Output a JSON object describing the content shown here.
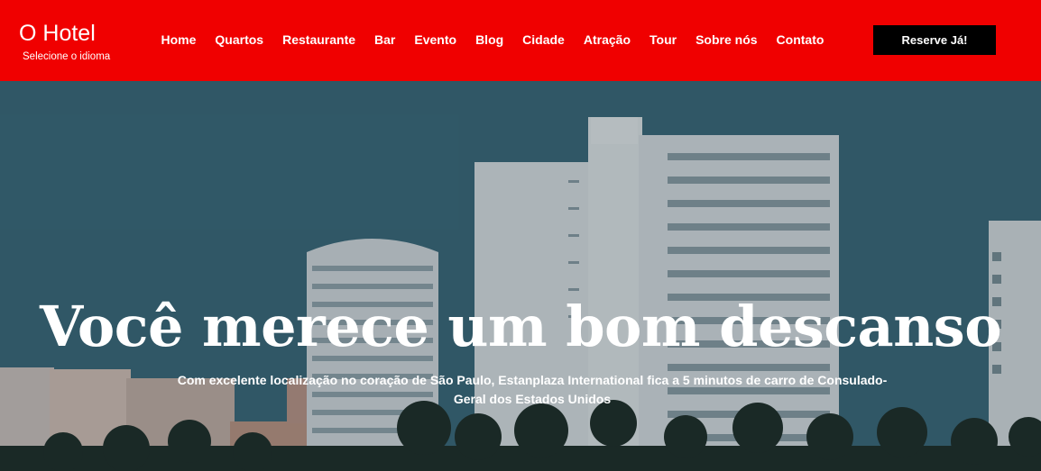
{
  "brand": {
    "title": "O Hotel",
    "language_label": "Selecione o idioma"
  },
  "nav": {
    "items": [
      {
        "label": "Home"
      },
      {
        "label": "Quartos"
      },
      {
        "label": "Restaurante"
      },
      {
        "label": "Bar"
      },
      {
        "label": "Evento"
      },
      {
        "label": "Blog"
      },
      {
        "label": "Cidade"
      },
      {
        "label": "Atração"
      },
      {
        "label": "Tour"
      },
      {
        "label": "Sobre nós"
      },
      {
        "label": "Contato"
      }
    ]
  },
  "cta": {
    "label": "Reserve Já!"
  },
  "hero": {
    "title": "Você merece um bom descanso",
    "subtitle": "Com excelente localização no coração de São Paulo, Estanplaza International fica a 5 minutos de carro de Consulado-Geral dos Estados Unidos"
  },
  "colors": {
    "header_bg": "#f00000",
    "cta_bg": "#000000",
    "text": "#ffffff"
  }
}
